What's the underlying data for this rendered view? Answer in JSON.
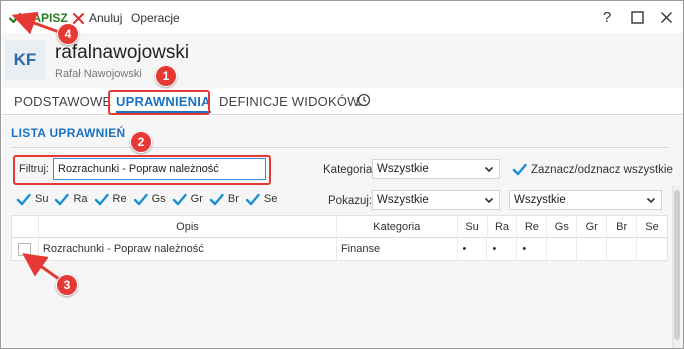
{
  "toolbar": {
    "save_label": "ZAPISZ",
    "cancel_label": "Anuluj",
    "ops_label": "Operacje",
    "help": "?",
    "maximize": "☐",
    "close": "✕"
  },
  "header": {
    "avatar_initials": "KF",
    "login": "rafalnawojowski",
    "full_name": "Rafał Nawojowski"
  },
  "tabs": [
    {
      "label": "PODSTAWOWE"
    },
    {
      "label": "UPRAWNIENIA"
    },
    {
      "label": "DEFINICJE WIDOKÓW"
    }
  ],
  "section": {
    "title": "LISTA UPRAWNIEŃ"
  },
  "filter": {
    "label": "Filtruj:",
    "value": "Rozrachunki - Popraw należność"
  },
  "category": {
    "label": "Kategoria:",
    "value": "Wszystkie"
  },
  "show": {
    "label": "Pokazuj:",
    "value": "Wszystkie",
    "value2": "Wszystkie"
  },
  "toggle_all_label": "Zaznacz/odznacz wszystkie",
  "flags": [
    {
      "label": "Su",
      "checked": true
    },
    {
      "label": "Ra",
      "checked": true
    },
    {
      "label": "Re",
      "checked": true
    },
    {
      "label": "Gs",
      "checked": true
    },
    {
      "label": "Gr",
      "checked": true
    },
    {
      "label": "Br",
      "checked": true
    },
    {
      "label": "Se",
      "checked": true
    }
  ],
  "grid": {
    "headers": {
      "opis": "Opis",
      "kategoria": "Kategoria",
      "su": "Su",
      "ra": "Ra",
      "re": "Re",
      "gs": "Gs",
      "gr": "Gr",
      "br": "Br",
      "se": "Se"
    },
    "rows": [
      {
        "opis": "Rozrachunki - Popraw należność",
        "kategoria": "Finanse",
        "su": "•",
        "ra": "•",
        "re": "•",
        "gs": "",
        "gr": "",
        "br": "",
        "se": ""
      }
    ]
  },
  "annotations": {
    "b1": "1",
    "b2": "2",
    "b3": "3",
    "b4": "4"
  },
  "colors": {
    "accent": "#1a73c0",
    "save_green": "#2a7a1f",
    "annotation_red": "#e53935"
  }
}
